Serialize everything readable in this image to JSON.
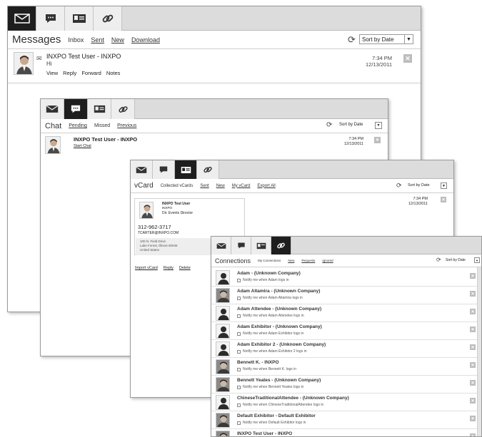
{
  "messages": {
    "title": "Messages",
    "nav": [
      "Inbox",
      "Sent",
      "New",
      "Download"
    ],
    "sort_label": "Sort by Date",
    "item": {
      "from": "INXPO Test User - INXPO",
      "body": "Hi",
      "time": "7:34 PM",
      "date": "12/13/2011",
      "actions": [
        "View",
        "Reply",
        "Forward",
        "Notes"
      ]
    }
  },
  "chat": {
    "title": "Chat",
    "nav": [
      "Pending",
      "Missed",
      "Previous"
    ],
    "sort_label": "Sort by Date",
    "item": {
      "from": "INXPO Test User - INXPO",
      "action": "Start Chat",
      "time": "7:34 PM",
      "date": "12/13/2011"
    }
  },
  "vcard": {
    "title": "vCard",
    "nav": [
      "Collected vCards",
      "Sent",
      "New",
      "My vCard",
      "Export All"
    ],
    "sort_label": "Sort by Date",
    "time": "7:34 PM",
    "date": "12/13/2011",
    "card": {
      "name": "INXPO Test User",
      "company": "INXPO",
      "position": "Dir. Events Director",
      "phone": "312-962-3717",
      "email": "TCARTER@INXPO.COM",
      "addr1": "100 N. Field Drive",
      "addr2": "Lake Forest, Illinois 60045",
      "country": "United States"
    },
    "actions": [
      "Import vCard",
      "Reply",
      "Delete"
    ]
  },
  "connections": {
    "title": "Connections",
    "nav": [
      "My Connections",
      "New",
      "Requests",
      "Ignored"
    ],
    "sort_label": "Sort by Date",
    "rows": [
      {
        "name": "Adam - (Unknown Company)",
        "note": "Notify me when Adam logs in",
        "icon": "person-silhouette"
      },
      {
        "name": "Adam Altamira - (Unknown Company)",
        "note": "Notify me when Adam Altamira logs in",
        "icon": "photo"
      },
      {
        "name": "Adam Attendee - (Unknown Company)",
        "note": "Notify me when Adam Attendee logs in",
        "icon": "person-silhouette"
      },
      {
        "name": "Adam Exhibitor - (Unknown Company)",
        "note": "Notify me when Adam Exhibitor logs in",
        "icon": "person-silhouette"
      },
      {
        "name": "Adam Exhibitor 2 - (Unknown Company)",
        "note": "Notify me when Adam Exhibitor 2 logs in",
        "icon": "person-silhouette"
      },
      {
        "name": "Bennett K. - INXPO",
        "note": "Notify me when Bennett K. logs in",
        "icon": "photo"
      },
      {
        "name": "Bennett Yeates - (Unknown Company)",
        "note": "Notify me when Bennett Yeates logs in",
        "icon": "photo"
      },
      {
        "name": "ChineseTraditionalAttendee - (Unknown Company)",
        "note": "Notify me when ChineseTraditionalAttendee logs in",
        "icon": "person-silhouette"
      },
      {
        "name": "Default Exhibitor - Default Exhibitor",
        "note": "Notify me when Default Exhibitor logs in",
        "icon": "photo"
      },
      {
        "name": "INXPO Test User - INXPO",
        "note": "",
        "icon": "photo"
      }
    ]
  }
}
